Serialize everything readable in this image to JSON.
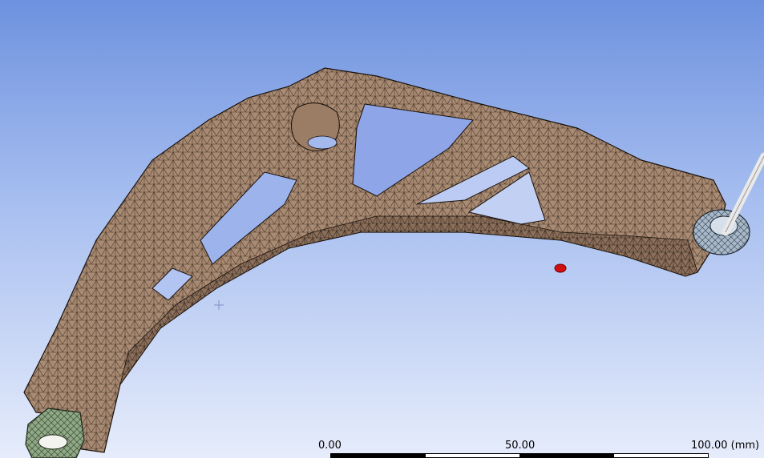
{
  "viewport": {
    "background_top": "#6e92df",
    "background_bottom": "#e6ecfb",
    "model_color": "#a98a72",
    "mesh_color": "#2a2018",
    "fixed_support_color": "#8fa885",
    "pin_color": "#a9b8c8",
    "force_marker_color": "#d01010"
  },
  "scale": {
    "label_0": "0.00",
    "label_mid": "50.00",
    "label_max": "100.00 (mm)"
  }
}
